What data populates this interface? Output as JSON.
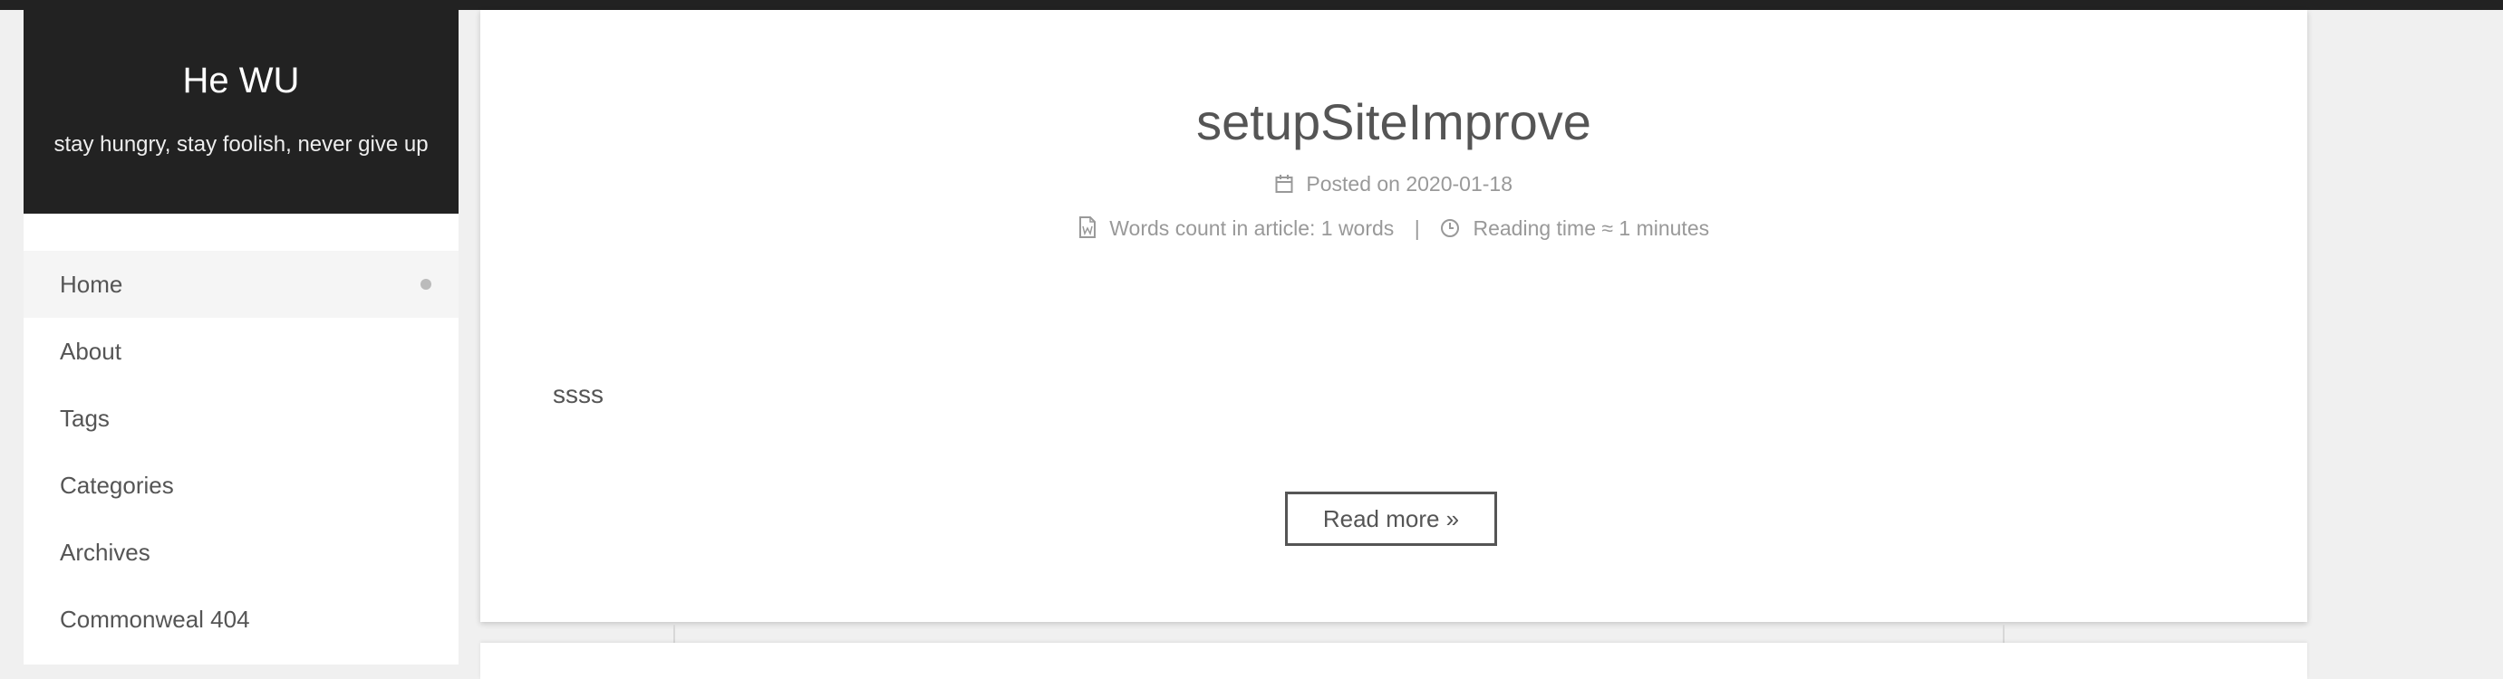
{
  "site": {
    "title": "He WU",
    "subtitle": "stay hungry, stay foolish, never give up"
  },
  "menu": {
    "items": [
      {
        "label": "Home",
        "active": true
      },
      {
        "label": "About"
      },
      {
        "label": "Tags"
      },
      {
        "label": "Categories"
      },
      {
        "label": "Archives"
      },
      {
        "label": "Commonweal 404"
      }
    ]
  },
  "post": {
    "title": "setupSiteImprove",
    "posted_on": "Posted on 2020-01-18",
    "words_count": "Words count in article: 1 words",
    "separator": "|",
    "reading_time": "Reading time ≈ 1 minutes",
    "body": "ssss",
    "read_more": "Read more »"
  },
  "colors": {
    "dark": "#222222",
    "text": "#555555",
    "meta": "#999999",
    "background": "#f0f0f0"
  },
  "icons": {
    "posted_on": "calendar-icon",
    "words_count": "file-word-icon",
    "reading_time": "clock-icon"
  }
}
